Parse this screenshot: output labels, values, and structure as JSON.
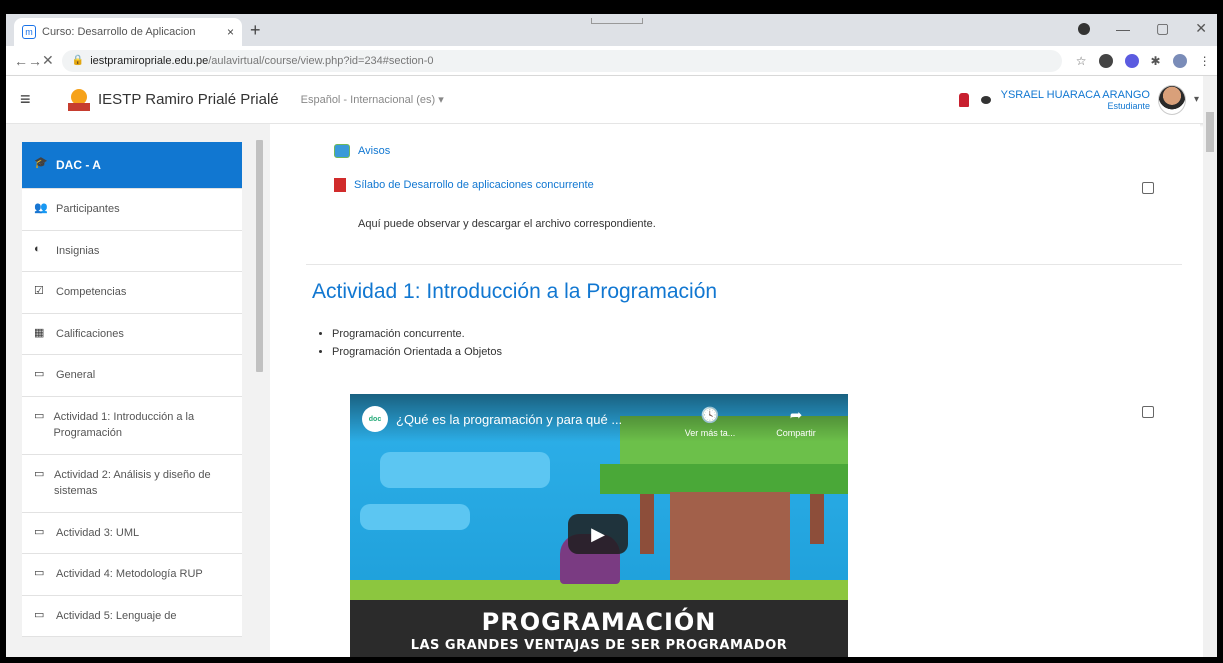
{
  "browser": {
    "tab_title": "Curso: Desarrollo de Aplicacion",
    "tab_close": "×",
    "new_tab": "+",
    "url_host": "iestpramiropriale.edu.pe",
    "url_path": "/aulavirtual/course/view.php?id=234#section-0",
    "window_controls": [
      "—",
      "▢",
      "✕"
    ]
  },
  "navbar": {
    "site_name": "IESTP Ramiro Prialé Prialé",
    "language": "Español - Internacional (es) ▾",
    "user_name": "YSRAEL HUARACA ARANGO",
    "user_role": "Estudiante"
  },
  "sidebar": {
    "items": [
      {
        "icon": "graduation-cap-icon",
        "glyph": "🎓",
        "label": "DAC - A",
        "active": true
      },
      {
        "icon": "users-icon",
        "glyph": "👥",
        "label": "Participantes"
      },
      {
        "icon": "badge-icon",
        "glyph": "◐",
        "label": "Insignias"
      },
      {
        "icon": "checklist-icon",
        "glyph": "☑",
        "label": "Competencias"
      },
      {
        "icon": "table-icon",
        "glyph": "▦",
        "label": "Calificaciones"
      },
      {
        "icon": "folder-icon",
        "glyph": "▭",
        "label": "General"
      },
      {
        "icon": "folder-icon",
        "glyph": "▭",
        "label": "Actividad 1: Introducción a la Programación"
      },
      {
        "icon": "folder-icon",
        "glyph": "▭",
        "label": "Actividad 2: Análisis y diseño de sistemas"
      },
      {
        "icon": "folder-icon",
        "glyph": "▭",
        "label": "Actividad 3: UML"
      },
      {
        "icon": "folder-icon",
        "glyph": "▭",
        "label": "Actividad 4: Metodología RUP"
      },
      {
        "icon": "folder-icon",
        "glyph": "▭",
        "label": "Actividad 5: Lenguaje de"
      }
    ]
  },
  "main": {
    "activity_forum": "Avisos",
    "activity_syllabus": "Sílabo de Desarrollo de aplicaciones concurrente",
    "syllabus_description": "Aquí puede observar y descargar el archivo correspondiente.",
    "section_title": "Actividad 1: Introducción a la Programación",
    "bullets": [
      "Programación concurrente.",
      "Programación Orientada a Objetos"
    ],
    "video": {
      "title": "¿Qué es la programación y para qué ...",
      "channel_badge": "doc",
      "watch_later": "Ver más ta...",
      "share": "Compartir",
      "banner_line1": "PROGRAMACIÓN",
      "banner_line2": "LAS GRANDES VENTAJAS DE SER PROGRAMADOR"
    }
  },
  "colors": {
    "accent": "#1177d1",
    "sidebar_bg": "#f2f2f2"
  }
}
